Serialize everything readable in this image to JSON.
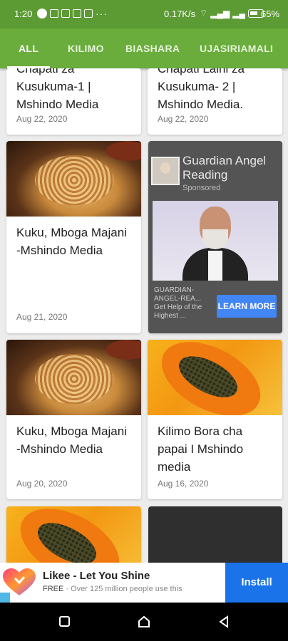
{
  "status_bar": {
    "time": "1:20",
    "net_speed": "0.17K/s",
    "battery_pct": "65%"
  },
  "tabs": [
    {
      "label": "ALL",
      "active": true
    },
    {
      "label": "KILIMO",
      "active": false
    },
    {
      "label": "BIASHARA",
      "active": false
    },
    {
      "label": "UJASIRIAMALI",
      "active": false
    }
  ],
  "articles": [
    {
      "title_top": "Chapati za",
      "title": "Kusukuma-1 | Mshindo Media",
      "date": "Aug 22, 2020"
    },
    {
      "title_top": "Chapati Laini za",
      "title": "Kusukuma- 2 | Mshindo Media.",
      "date": "Aug 22, 2020"
    },
    {
      "title": "Kuku, Mboga Majani -Mshindo Media",
      "date": "Aug 21, 2020",
      "image": "noodles-plate"
    },
    {
      "title": "Kuku, Mboga Majani -Mshindo Media",
      "date": "Aug 20, 2020",
      "image": "noodles-plate"
    },
    {
      "title": "Kilimo Bora cha papai I Mshindo media",
      "date": "Aug 16, 2020",
      "image": "papaya"
    }
  ],
  "ad_card": {
    "title": "Guardian Angel Reading",
    "sponsored": "Sponsored",
    "small_text": "GUARDIAN-ANGEL-REA... Get Help of the Highest ...",
    "cta": "LEARN MORE"
  },
  "banner_ad": {
    "title": "Likee - Let You Shine",
    "free": "FREE",
    "subtitle": " · Over 125 million people use this",
    "install": "Install"
  },
  "colors": {
    "primary_green": "#6aad3c",
    "status_green": "#5c9a34",
    "install_blue": "#1a73e8"
  }
}
